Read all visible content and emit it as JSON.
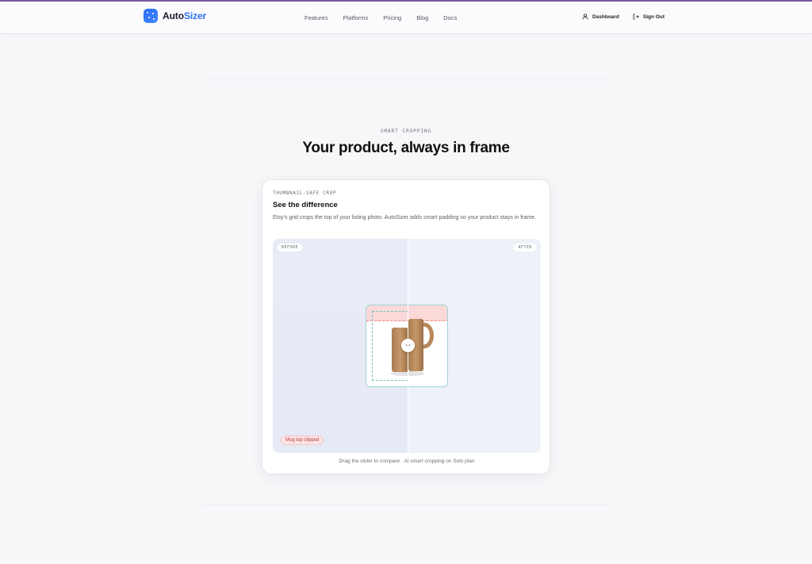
{
  "header": {
    "logo_prefix": "Auto",
    "logo_accent": "Sizer",
    "nav": [
      "Features",
      "Platforms",
      "Pricing",
      "Blog",
      "Docs"
    ],
    "dashboard_label": "Dashboard",
    "signout_label": "Sign Out",
    "icons": {
      "dashboard": "user-icon",
      "signout": "logout-icon"
    }
  },
  "hero": {
    "eyebrow": "SMART CROPPING",
    "title": "Your product, always in frame"
  },
  "card": {
    "eyebrow": "THUMBNAIL-SAFE CROP",
    "title": "See the difference",
    "description": "Etsy's grid crops the top of your listing photo. AutoSizer adds smart padding so your product stays in frame.",
    "before_label": "BEFORE",
    "after_label": "AFTER",
    "clipped_badge": "Mug top clipped",
    "handle_glyph": "‹›",
    "caption": "Drag the slider to compare · AI smart cropping on Solo plan"
  },
  "colors": {
    "brand": "#2e6ff2",
    "clip_zone": "#fbd9d9",
    "safe_zone": "#6fc4c0",
    "mug": "#b8875a"
  }
}
